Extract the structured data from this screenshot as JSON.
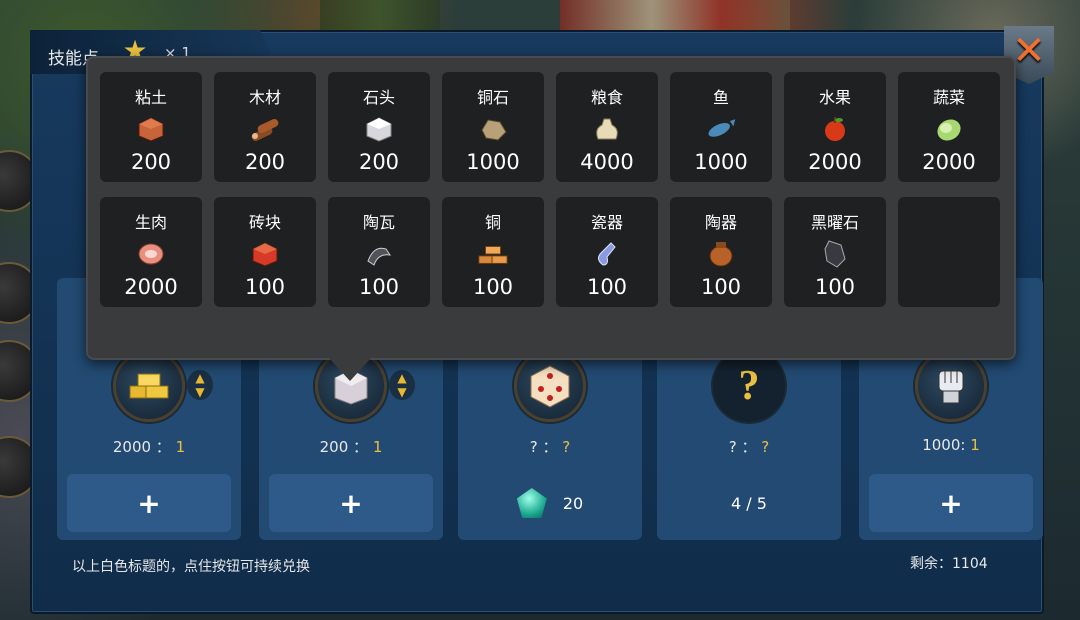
{
  "header": {
    "skill_label": "技能点",
    "skill_count": "× 1"
  },
  "close_label": "✕",
  "resources": [
    {
      "name": "粘土",
      "qty": "200",
      "icon": "clay-icon",
      "color": "#c8643a"
    },
    {
      "name": "木材",
      "qty": "200",
      "icon": "wood-icon",
      "color": "#8a4a22"
    },
    {
      "name": "石头",
      "qty": "200",
      "icon": "stone-icon",
      "color": "#d8d8dc"
    },
    {
      "name": "铜石",
      "qty": "1000",
      "icon": "copper-ore-icon",
      "color": "#b8a078"
    },
    {
      "name": "粮食",
      "qty": "4000",
      "icon": "grain-sack-icon",
      "color": "#e8dcb8"
    },
    {
      "name": "鱼",
      "qty": "1000",
      "icon": "fish-icon",
      "color": "#4a8ab8"
    },
    {
      "name": "水果",
      "qty": "2000",
      "icon": "apple-icon",
      "color": "#d83a18"
    },
    {
      "name": "蔬菜",
      "qty": "2000",
      "icon": "lettuce-icon",
      "color": "#a8d870"
    },
    {
      "name": "生肉",
      "qty": "2000",
      "icon": "meat-icon",
      "color": "#e89080"
    },
    {
      "name": "砖块",
      "qty": "100",
      "icon": "brick-icon",
      "color": "#d83a2a"
    },
    {
      "name": "陶瓦",
      "qty": "100",
      "icon": "roof-tile-icon",
      "color": "#505458"
    },
    {
      "name": "铜",
      "qty": "100",
      "icon": "copper-ingot-icon",
      "color": "#d8883a"
    },
    {
      "name": "瓷器",
      "qty": "100",
      "icon": "porcelain-vase-icon",
      "color": "#8a9ae0"
    },
    {
      "name": "陶器",
      "qty": "100",
      "icon": "pottery-icon",
      "color": "#b8622a"
    },
    {
      "name": "黑曜石",
      "qty": "100",
      "icon": "obsidian-icon",
      "color": "#383a40"
    }
  ],
  "cards": [
    {
      "icon": "gold-bars-icon",
      "ratio_left": "2000 ：",
      "ratio_right": "1",
      "button": "+",
      "has_arrow": true
    },
    {
      "icon": "stone-block-icon",
      "ratio_left": "200 ：",
      "ratio_right": "1",
      "button": "+",
      "has_arrow": true
    },
    {
      "icon": "dice-icon",
      "ratio_left": "? ：",
      "ratio_right": "?",
      "button": "20",
      "has_arrow": false,
      "gem": true
    },
    {
      "icon": "question-icon",
      "ratio_left": "? ：",
      "ratio_right": "?",
      "button": "4 / 5",
      "has_arrow": false
    },
    {
      "icon": "fist-icon",
      "ratio_left": "1000:",
      "ratio_right": "1",
      "button": "+",
      "has_arrow": false
    }
  ],
  "footer": {
    "hint": "以上白色标题的，点住按钮可持续兑换",
    "remaining": "剩余：1104"
  }
}
